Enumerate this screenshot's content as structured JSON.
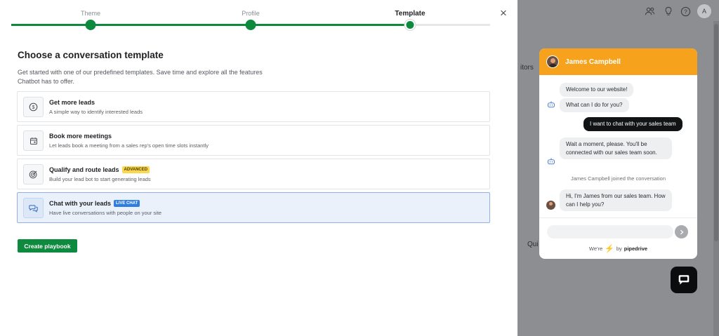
{
  "stepper": {
    "steps": [
      {
        "label": "Theme"
      },
      {
        "label": "Profile"
      },
      {
        "label": "Template"
      }
    ],
    "active_step": 3
  },
  "close_label": "×",
  "main": {
    "title": "Choose a conversation template",
    "subtitle": "Get started with one of our predefined templates. Save time and explore all the features Chatbot has to offer."
  },
  "templates": [
    {
      "title": "Get more leads",
      "desc": "A simple way to identify interested leads",
      "icon": "dollar-circle-icon",
      "badge": ""
    },
    {
      "title": "Book more meetings",
      "desc": "Let leads book a meeting from a sales rep's open time slots instantly",
      "icon": "calendar-icon",
      "badge": ""
    },
    {
      "title": "Qualify and route leads",
      "desc": "Build your lead bot to start generating leads",
      "icon": "target-icon",
      "badge": "ADVANCED"
    },
    {
      "title": "Chat with your leads",
      "desc": "Have live conversations with people on your site",
      "icon": "chat-bubbles-icon",
      "badge": "LIVE CHAT",
      "selected": true
    }
  ],
  "create_button": "Create playbook",
  "background": {
    "text_visitors": "itors",
    "text_qui": "Qui",
    "avatar_initial": "A",
    "top_icons": [
      "contacts-icon",
      "lightbulb-icon",
      "help-icon"
    ]
  },
  "chat": {
    "agent_name": "James Campbell",
    "messages": {
      "m1": "Welcome to our website!",
      "m2": "What can I do for you?",
      "user": "I want to chat with your sales team",
      "m3": "Wait a moment, please. You'll be connected with our sales team soon.",
      "system": "James Campbell joined the conversation",
      "m4": "Hi, I'm James from our sales team. How can I help you?"
    },
    "powered_prefix": "We're",
    "powered_by": "by",
    "brand": "pipedrive"
  },
  "colors": {
    "brand_green": "#0d8a3e",
    "chat_header": "#f7a21c",
    "selected_bg": "#eaf1fb",
    "badge_advanced": "#fbd84b",
    "badge_live": "#2f7de1"
  }
}
